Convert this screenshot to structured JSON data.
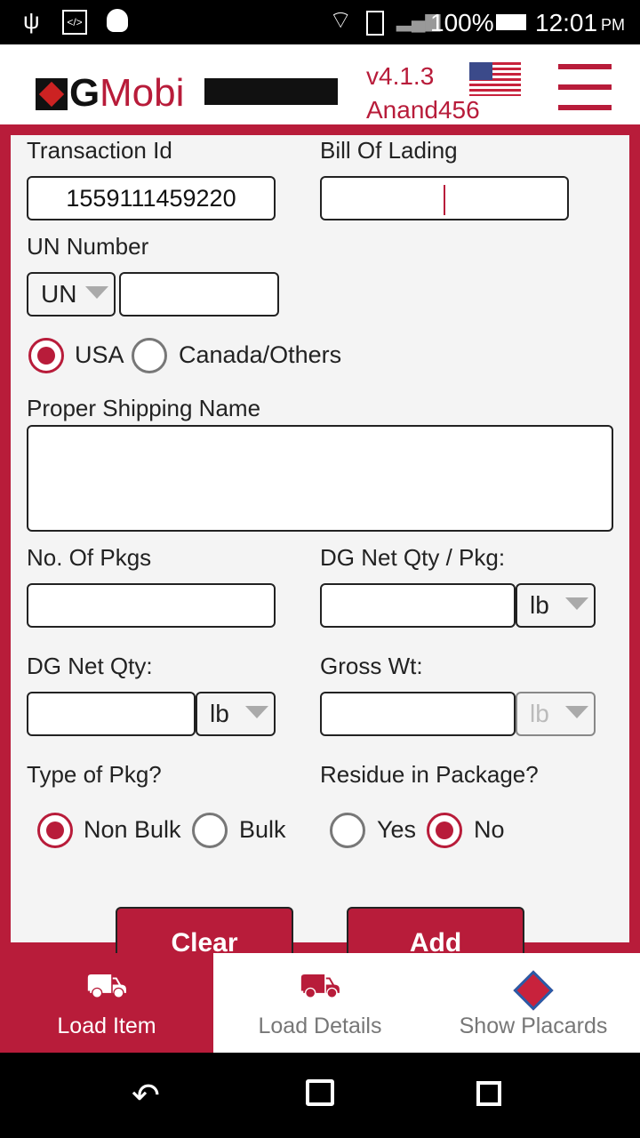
{
  "status_bar": {
    "battery": "100%",
    "time": "12:01",
    "ampm": "PM"
  },
  "header": {
    "logo": "DGMobi",
    "version": "v4.1.3",
    "user": "Anand456",
    "flag": "usa-flag-icon",
    "menu": "hamburger-icon"
  },
  "form": {
    "transaction_id_label": "Transaction Id",
    "transaction_id_value": "1559111459220",
    "bill_of_lading_label": "Bill Of Lading",
    "bill_of_lading_value": "",
    "un_number_label": "UN Number",
    "un_prefix": "UN",
    "un_number_value": "",
    "region_options": [
      {
        "label": "USA",
        "selected": true
      },
      {
        "label": "Canada/Others",
        "selected": false
      }
    ],
    "proper_shipping_name_label": "Proper Shipping Name",
    "proper_shipping_name_value": "",
    "num_pkgs_label": "No. Of Pkgs",
    "num_pkgs_value": "",
    "net_qty_per_pkg_label": "DG Net Qty / Pkg:",
    "net_qty_per_pkg_unit": "lb",
    "net_qty_label": "DG Net Qty:",
    "net_qty_unit": "lb",
    "gross_wt_label": "Gross Wt:",
    "gross_wt_unit": "lb",
    "type_of_pkg_label": "Type of Pkg?",
    "type_of_pkg_options": [
      {
        "label": "Non Bulk",
        "selected": true
      },
      {
        "label": "Bulk",
        "selected": false
      }
    ],
    "residue_label": "Residue in Package?",
    "residue_options": [
      {
        "label": "Yes",
        "selected": false
      },
      {
        "label": "No",
        "selected": true
      }
    ],
    "clear_label": "Clear",
    "add_label": "Add"
  },
  "tabs": [
    {
      "label": "Load Item",
      "active": true
    },
    {
      "label": "Load Details",
      "active": false
    },
    {
      "label": "Show Placards",
      "active": false
    }
  ],
  "colors": {
    "accent": "#b81c3a"
  }
}
